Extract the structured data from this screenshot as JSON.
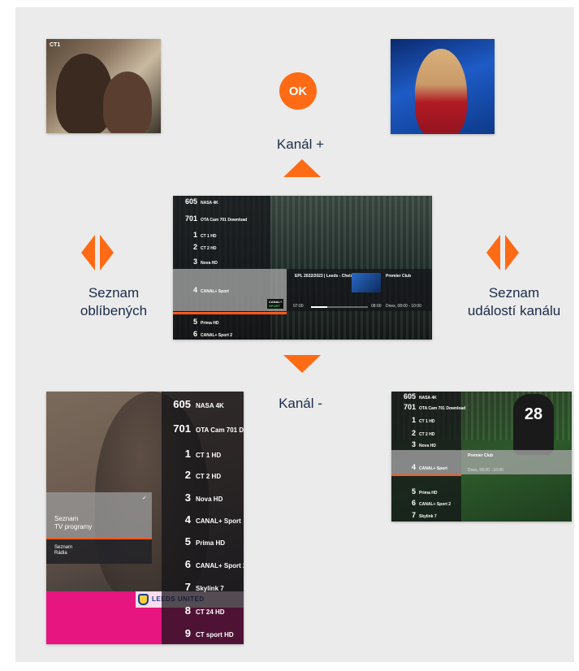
{
  "ok_label": "OK",
  "nav": {
    "up_label": "Kanál +",
    "down_label": "Kanál -",
    "left_line1": "Seznam",
    "left_line2": "oblíbených",
    "right_line1": "Seznam",
    "right_line2": "událostí kanálu"
  },
  "colors": {
    "accent": "#ff6a14",
    "label": "#1a2b4a",
    "panel": "#ebebeb"
  },
  "icons": [
    "ok-button-icon",
    "arrow-up-icon",
    "arrow-down-icon",
    "left-right-arrows-icon"
  ],
  "thumbnails": {
    "top_left_channel": "CT1",
    "center": {
      "channels": [
        {
          "num": "605",
          "name": "NASA 4K"
        },
        {
          "num": "701",
          "name": "OTA Cam 701 Download"
        },
        {
          "num": "1",
          "name": "CT 1 HD"
        },
        {
          "num": "2",
          "name": "CT 2 HD"
        },
        {
          "num": "3",
          "name": "Nova HD"
        },
        {
          "num": "4",
          "name": "CANAL+ Sport"
        },
        {
          "num": "5",
          "name": "Prima HD"
        },
        {
          "num": "6",
          "name": "CANAL+ Sport 2"
        }
      ],
      "event_title": "EPL 2022/2023 | Leeds - Chelsea",
      "next_event": "Premier Club",
      "time_start": "07:00",
      "time_end": "08:00",
      "next_time": "Dnes, 08:00 - 10:00",
      "badge_top": "CANAL+",
      "badge_bottom": "SPORT"
    },
    "bottom_left": {
      "channels": [
        {
          "num": "605",
          "name": "NASA 4K"
        },
        {
          "num": "701",
          "name": "OTA Cam 701 Down"
        },
        {
          "num": "1",
          "name": "CT 1 HD"
        },
        {
          "num": "2",
          "name": "CT 2 HD"
        },
        {
          "num": "3",
          "name": "Nova HD"
        },
        {
          "num": "4",
          "name": "CANAL+ Sport"
        },
        {
          "num": "5",
          "name": "Prima HD"
        },
        {
          "num": "6",
          "name": "CANAL+ Sport 2"
        },
        {
          "num": "7",
          "name": "Skylink 7"
        },
        {
          "num": "8",
          "name": "CT 24 HD"
        },
        {
          "num": "9",
          "name": "CT sport HD"
        }
      ],
      "menu_item1_line1": "Seznam",
      "menu_item1_line2": "TV programy",
      "menu_item2_line1": "Seznam",
      "menu_item2_line2": "Rádia",
      "banner": "LEEDS UNITED"
    },
    "bottom_right": {
      "channels": [
        {
          "num": "605",
          "name": "NASA 4K"
        },
        {
          "num": "701",
          "name": "OTA Cam 701 Download"
        },
        {
          "num": "1",
          "name": "CT 1 HD"
        },
        {
          "num": "2",
          "name": "CT 2 HD"
        },
        {
          "num": "3",
          "name": "Nova HD"
        },
        {
          "num": "4",
          "name": "CANAL+ Sport"
        },
        {
          "num": "5",
          "name": "Prima HD"
        },
        {
          "num": "6",
          "name": "CANAL+ Sport 2"
        },
        {
          "num": "7",
          "name": "Skylink 7"
        }
      ],
      "event": "Premier Club",
      "next_time": "Dnes, 08:00 - 10:00",
      "jersey_number": "28"
    }
  }
}
